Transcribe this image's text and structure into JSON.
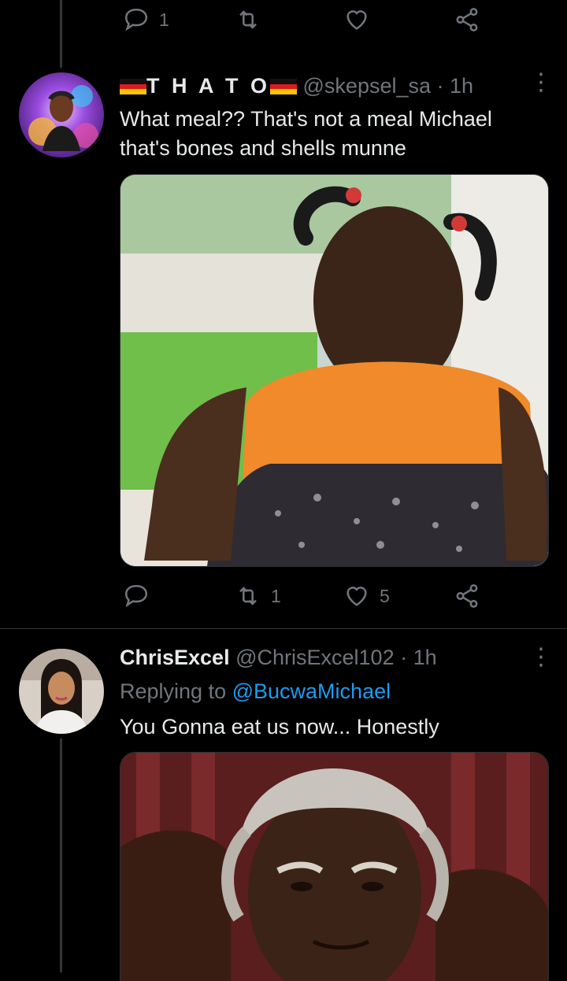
{
  "top_actions": {
    "reply_count": "1"
  },
  "tweets": [
    {
      "display_name": "T H A T O",
      "handle": "@skepsel_sa",
      "time": "· 1h",
      "text_line1": "What meal?? That's not a meal Michael",
      "text_line2": "that's bones and shells munne",
      "retweets": "1",
      "likes": "5"
    },
    {
      "display_name": "ChrisExcel",
      "handle": "@ChrisExcel102",
      "time": "· 1h",
      "replying_label": "Replying to",
      "replying_to": "@BucwaMichael",
      "text": "You Gonna eat us now... Honestly"
    }
  ],
  "icons": [
    "reply-icon",
    "retweet-icon",
    "like-icon",
    "share-icon",
    "more-icon",
    "flag-icon"
  ],
  "colors": {
    "background": "#000000",
    "text": "#e7e9ea",
    "muted": "#71767b",
    "link": "#1d9bf0"
  }
}
